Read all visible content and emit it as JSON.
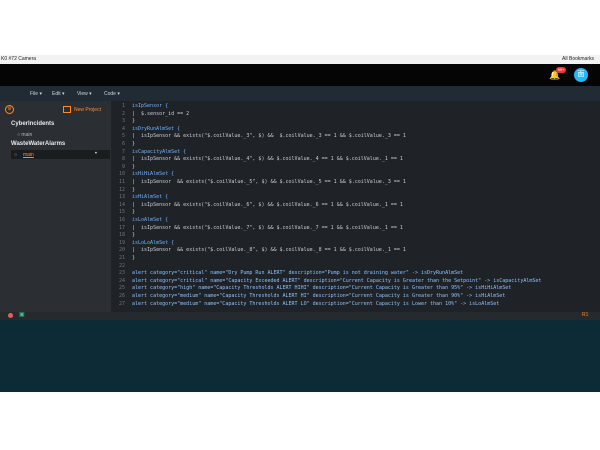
{
  "titlebar": {
    "title": "K0 #72 Camera",
    "right": "All Bookmarks"
  },
  "header": {
    "notification_count": "99+",
    "avatar_initials": "面"
  },
  "menu": [
    "File ▾",
    "Edit ▾",
    "View ▾",
    "Code ▾"
  ],
  "sidebar": {
    "new_project": "New Project",
    "projects": [
      {
        "name": "CyberIncidents",
        "items": [
          "main"
        ]
      },
      {
        "name": "WasteWaterAlarms",
        "items": [
          "main"
        ]
      }
    ]
  },
  "editor": {
    "lines": [
      {
        "n": "1",
        "t": "isIpSensor {"
      },
      {
        "n": "2",
        "t": "|  $.sensor_id == 2"
      },
      {
        "n": "3",
        "t": "}"
      },
      {
        "n": "4",
        "t": "isDryRunAlmSet {"
      },
      {
        "n": "5",
        "t": "|  isIpSensor && exists(\"$.coilValue._3\", $) &&  $.coilValue._3 == 1 && $.coilValue._3 == 1"
      },
      {
        "n": "6",
        "t": "}"
      },
      {
        "n": "7",
        "t": "isCapacityAlmSet {"
      },
      {
        "n": "8",
        "t": "|  isIpSensor && exists(\"$.coilValue._4\", $) && $.coilValue._4 == 1 && $.coilValue._1 == 1"
      },
      {
        "n": "9",
        "t": "}"
      },
      {
        "n": "10",
        "t": "isHiHiAlmSet {"
      },
      {
        "n": "11",
        "t": "|  isIpSensor  && exists(\"$.coilValue._5\", $) && $.coilValue._5 == 1 && $.coilValue._3 == 1"
      },
      {
        "n": "12",
        "t": "}"
      },
      {
        "n": "13",
        "t": "isHiAlmSet {"
      },
      {
        "n": "14",
        "t": "|  isIpSensor && exists(\"$.coilValue._6\", $) && $.coilValue._6 == 1 && $.coilValue._1 == 1"
      },
      {
        "n": "15",
        "t": "}"
      },
      {
        "n": "16",
        "t": "isLoAlmSet {"
      },
      {
        "n": "17",
        "t": "|  isIpSensor && exists(\"$.coilValue._7\", $) && $.coilValue._7 == 1 && $.coilValue._1 == 1"
      },
      {
        "n": "18",
        "t": "}"
      },
      {
        "n": "19",
        "t": "isLoLoAlmSet {"
      },
      {
        "n": "20",
        "t": "|  isIpSensor  && exists(\"$.coilValue._8\", $) && $.coilValue._8 == 1 && $.coilValue._1 == 1"
      },
      {
        "n": "21",
        "t": "}"
      },
      {
        "n": "22",
        "t": ""
      },
      {
        "n": "23",
        "t": "alert category=\"critical\" name=\"Dry Pump Run ALERT\" description=\"Pump is not draining water\" -> isDryRunAlmSet"
      },
      {
        "n": "24",
        "t": "alert category=\"critical\" name=\"Capacity Exceeded ALERT\" description=\"Current Capacity is Greater than the Setpoint\" -> isCapacityAlmSet"
      },
      {
        "n": "25",
        "t": "alert category=\"high\" name=\"Capacity Thresholds ALERT HIHI\" description=\"Current Capacity is Greater than 95%\" -> isHiHiAlmSet"
      },
      {
        "n": "26",
        "t": "alert category=\"medium\" name=\"Capacity Thresholds ALERT HI\" description=\"Current Capacity is Greater than 90%\" -> isHiAlmSet"
      },
      {
        "n": "27",
        "t": "alert category=\"medium\" name=\"Capacity Thresholds ALERT LO\" description=\"Current Capacity is Lower than 10%\" -> isLoAlmSet"
      }
    ]
  },
  "status": {
    "right": "R1"
  },
  "colors": {
    "accent": "#ff8a2b",
    "editor_bg": "#1f2226",
    "sidebar_bg": "#2b2f33",
    "bottom_bg": "#0d2b36"
  }
}
